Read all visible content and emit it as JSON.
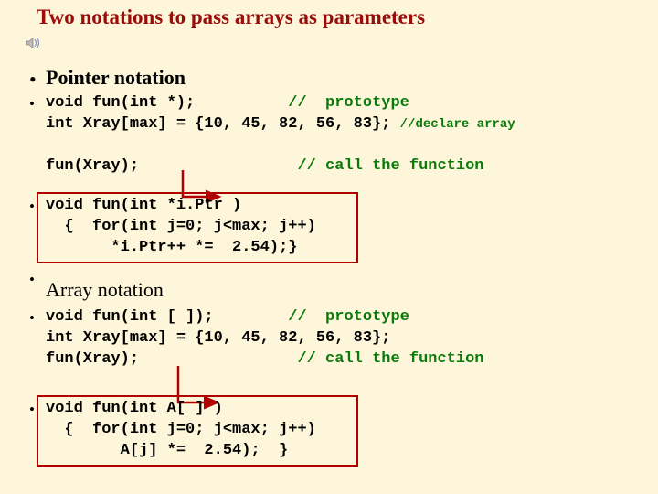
{
  "title": "Two notations to pass arrays as parameters",
  "heading1": "Pointer notation",
  "heading2": "Array notation",
  "icon_name": "speaker-icon",
  "ptr": {
    "proto_code": "void fun(int *);          ",
    "proto_cmt": "//  prototype",
    "decl_code": "int Xray[max] = {10, 45, 82, 56, 83}; ",
    "decl_cmt": "//declare array",
    "call_code": "fun(Xray);                 ",
    "call_cmt": "// call the function",
    "def_l1": "void fun(int *i.Ptr )",
    "def_l2": "  {  for(int j=0; j<max; j++)",
    "def_l3": "       *i.Ptr++ *=  2.54);}"
  },
  "arr": {
    "proto_code": "void fun(int [ ]);        ",
    "proto_cmt": "//  prototype",
    "decl_code": "int Xray[max] = {10, 45, 82, 56, 83};",
    "call_code": "fun(Xray);                 ",
    "call_cmt": "// call the function",
    "def_l1": "void fun(int A[ ] )",
    "def_l2": "  {  for(int j=0; j<max; j++)",
    "def_l3": "        A[j] *=  2.54);  }"
  }
}
